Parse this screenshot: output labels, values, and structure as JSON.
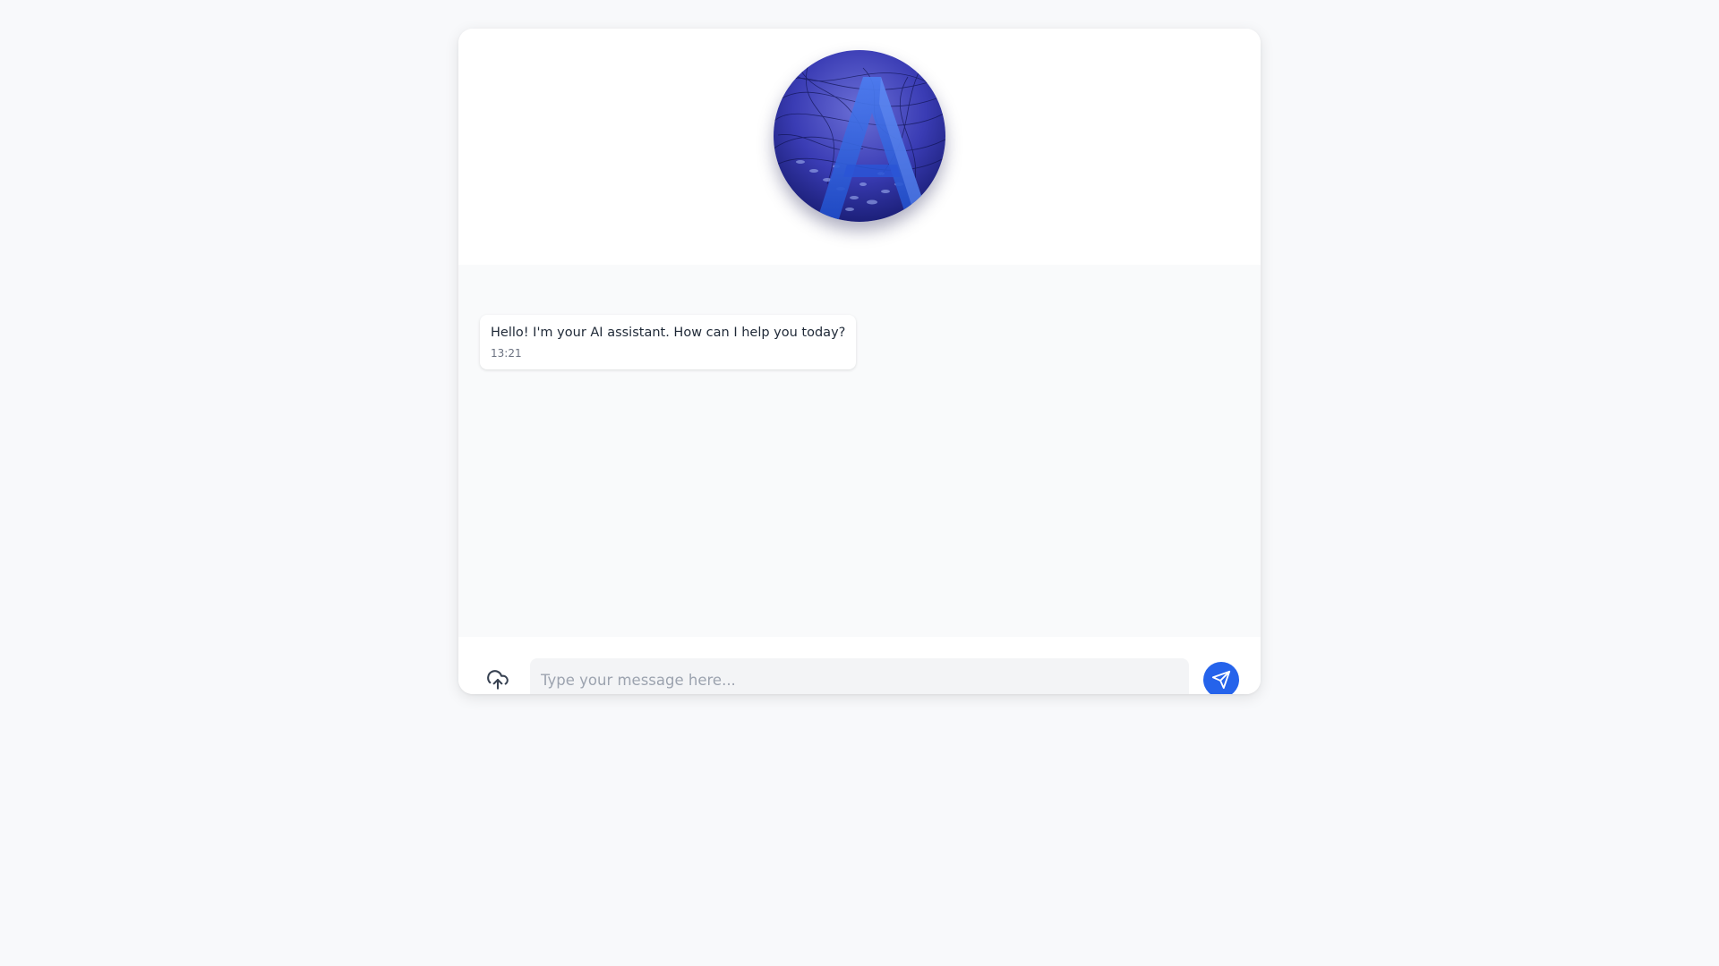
{
  "assistant": {
    "avatar_icon": "assistant-logo-letter-a",
    "avatar_letter": "A",
    "avatar_colors": {
      "background": "#2a2c9e",
      "letter": "#2e5fe0"
    }
  },
  "messages": [
    {
      "sender": "assistant",
      "text": "Hello! I'm your AI assistant. How can I help you today?",
      "time": "13:21"
    }
  ],
  "composer": {
    "upload_icon": "cloud-upload-icon",
    "input_value": "",
    "placeholder": "Type your message here...",
    "send_icon": "send-paper-plane-icon"
  },
  "colors": {
    "accent": "#2563eb",
    "page_background": "#f8f9fb",
    "messages_background": "#f9fafb",
    "input_background": "#f3f4f6"
  }
}
